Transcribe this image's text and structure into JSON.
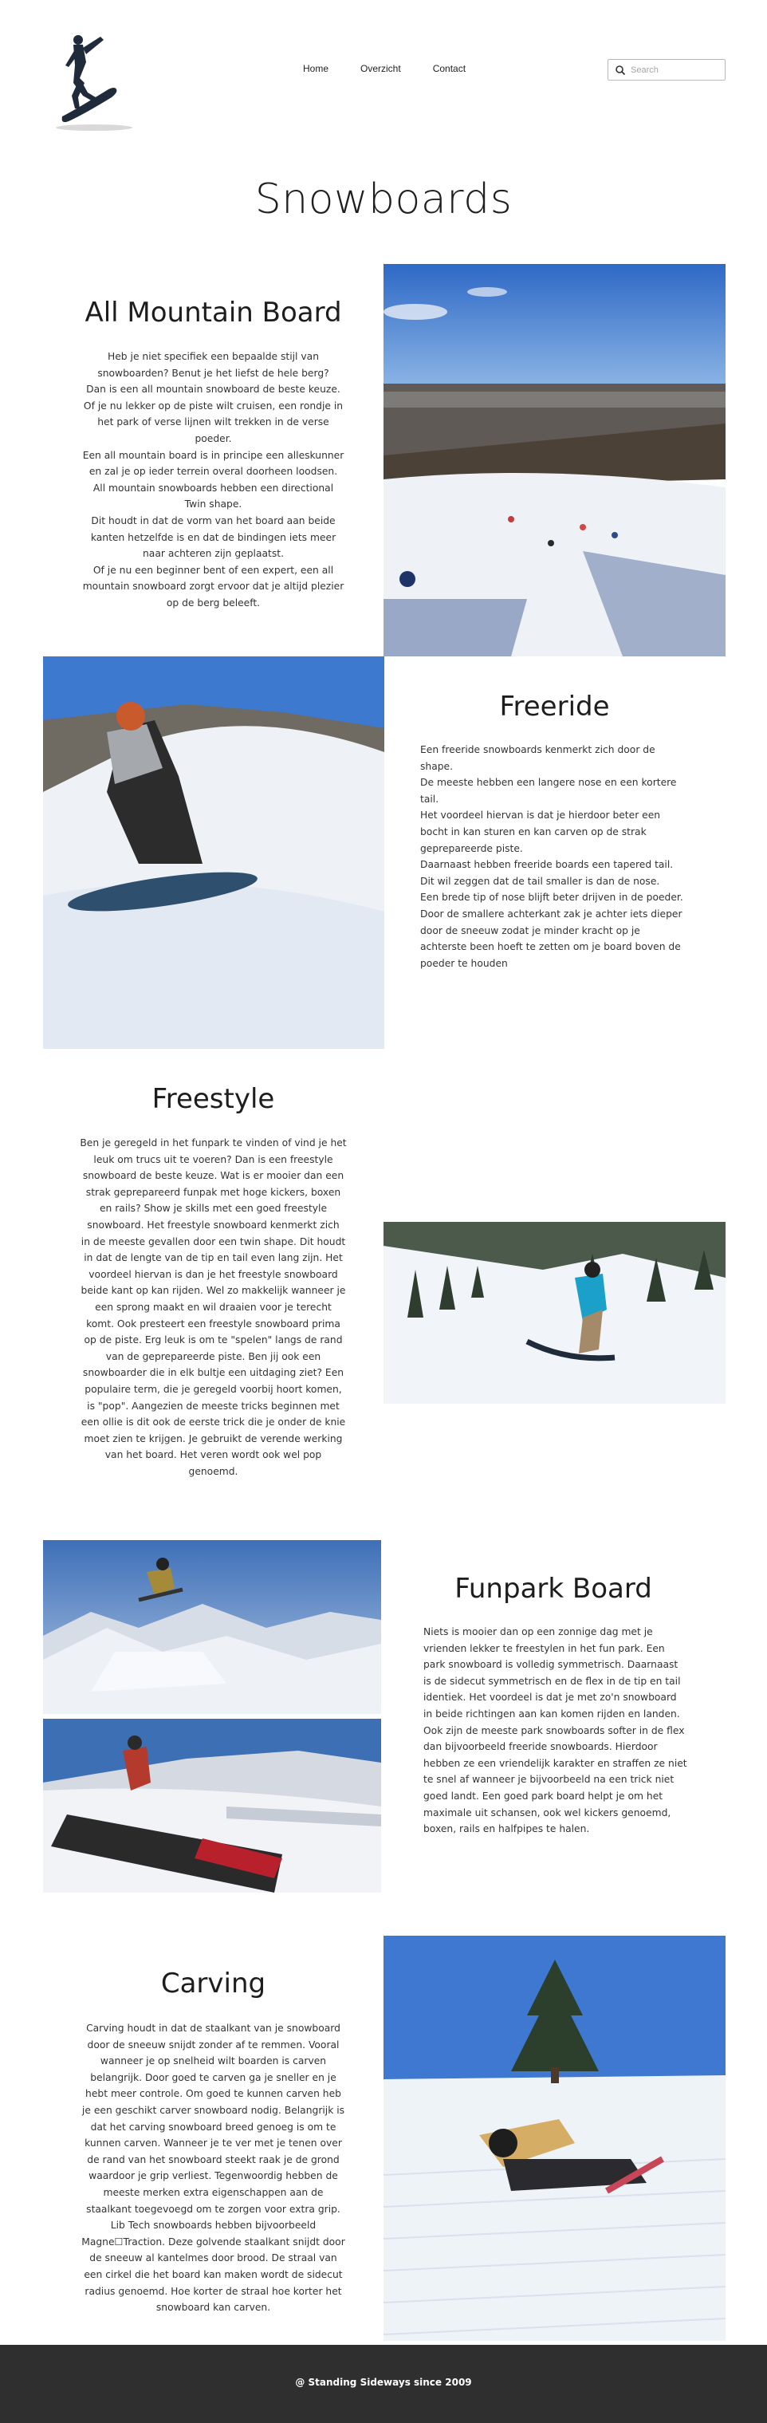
{
  "nav": {
    "home": "Home",
    "overzicht": "Overzicht",
    "contact": "Contact"
  },
  "search": {
    "placeholder": "Search"
  },
  "page_title": "Snowboards",
  "sections": {
    "all_mountain": {
      "title": "All Mountain Board",
      "text": "Heb je niet specifiek een bepaalde stijl van\nsnowboarden? Benut je het liefst de hele berg?\nDan is een all mountain snowboard de beste keuze.\nOf je nu lekker op de piste wilt cruisen, een rondje in\nhet park of verse lijnen wilt trekken in de verse\npoeder.\nEen all mountain board is in principe een alleskunner\nen zal je op ieder terrein overal doorheen loodsen.\nAll mountain snowboards hebben een directional\nTwin shape.\nDit houdt in dat de vorm van het board aan beide\nkanten hetzelfde is en dat de bindingen iets meer\nnaar achteren zijn geplaatst.\nOf je nu een beginner bent of een expert, een all\nmountain snowboard zorgt ervoor dat je altijd plezier\nop de berg beleeft."
    },
    "freeride": {
      "title": "Freeride",
      "text": "Een freeride snowboards kenmerkt zich door de\nshape.\nDe meeste hebben een langere nose en een kortere\ntail.\nHet voordeel hiervan is dat je hierdoor beter een\nbocht in kan sturen en kan carven op de strak\ngeprepareerde piste.\nDaarnaast hebben freeride boards een tapered tail.\nDit wil zeggen dat de tail smaller is dan de nose.\nEen brede tip of nose blijft beter drijven in de poeder.\nDoor de smallere achterkant zak je achter iets dieper\ndoor de sneeuw zodat je minder kracht op je\nachterste been hoeft te zetten om je board boven de\npoeder te houden"
    },
    "freestyle": {
      "title": "Freestyle",
      "text": "Ben je geregeld in het funpark te vinden of vind je het\nleuk om trucs uit te voeren? Dan is een freestyle\nsnowboard de beste keuze. Wat is er mooier dan een\nstrak geprepareerd funpak met hoge kickers, boxen\nen rails? Show je skills met een goed freestyle\nsnowboard. Het freestyle snowboard kenmerkt zich\nin de meeste gevallen door een twin shape. Dit houdt\nin dat de lengte van de tip en tail even lang zijn. Het\nvoordeel hiervan is dan je het freestyle snowboard\nbeide kant op kan rijden. Wel zo makkelijk wanneer je\neen sprong maakt en wil draaien voor je terecht\nkomt. Ook presteert een freestyle snowboard prima\nop de piste. Erg leuk is om te \"spelen\" langs de rand\nvan de geprepareerde piste. Ben jij ook een\nsnowboarder die in elk bultje een uitdaging ziet? Een\npopulaire term, die je geregeld voorbij hoort komen,\nis \"pop\". Aangezien de meeste tricks beginnen met\neen ollie is dit ook de eerste trick die je onder de knie\nmoet zien te krijgen. Je gebruikt de verende werking\nvan het board. Het veren wordt ook wel pop\ngenoemd."
    },
    "funpark": {
      "title": "Funpark Board",
      "text": "Niets is mooier dan op een zonnige dag met je\nvrienden lekker te freestylen in het fun park. Een\npark snowboard is volledig symmetrisch. Daarnaast\nis de sidecut symmetrisch en de flex in de tip en tail\nidentiek. Het voordeel is dat je met zo'n snowboard\nin beide richtingen aan kan komen rijden en landen.\nOok zijn de meeste park snowboards softer in de flex\ndan bijvoorbeeld freeride snowboards. Hierdoor\nhebben ze een vriendelijk karakter en straffen ze niet\nte snel af wanneer je bijvoorbeeld na een trick niet\ngoed landt. Een goed park board helpt je om het\nmaximale uit schansen, ook wel kickers genoemd,\nboxen, rails en halfpipes te halen."
    },
    "carving": {
      "title": "Carving",
      "text": "Carving houdt in dat de staalkant van je snowboard\ndoor de sneeuw snijdt zonder af te remmen. Vooral\nwanneer je op snelheid wilt boarden is carven\nbelangrijk. Door goed te carven ga je sneller en je\nhebt meer controle. Om goed te kunnen carven heb\nje een geschikt carver snowboard nodig. Belangrijk is\ndat het carving snowboard breed genoeg is om te\nkunnen carven. Wanneer je te ver met je tenen over\nde rand van het snowboard steekt raak je de grond\nwaardoor je grip verliest. Tegenwoordig hebben de\nmeeste merken extra eigenschappen aan de\nstaalkant toegevoegd om te zorgen voor extra grip.\nLib Tech snowboards hebben bijvoorbeeld\nMagne☐Traction. Deze golvende staalkant snijdt door\nde sneeuw al kantelmes door brood. De straal van\neen cirkel die het board kan maken wordt de sidecut\nradius genoemd. Hoe korter de straal hoe korter het\nsnowboard kan carven."
    }
  },
  "footer": {
    "text": "@ Standing Sideways since 2009"
  },
  "icons": {
    "logo": "snowboarder-logo",
    "search": "search-icon"
  },
  "colors": {
    "footer_bg": "#2f2f2f",
    "sky": "#3f74c8",
    "snow": "#eef3f8"
  }
}
